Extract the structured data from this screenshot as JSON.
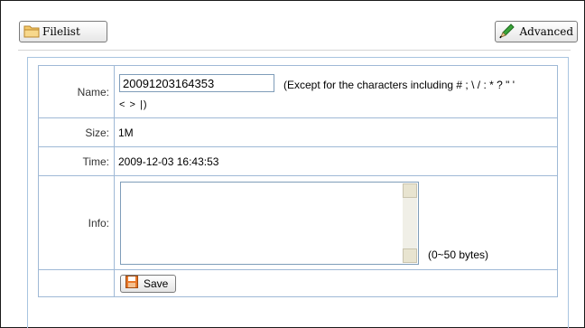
{
  "toolbar": {
    "filelist_label": "Filelist",
    "filelist_icon": "folder-icon",
    "advanced_label": "Advanced",
    "advanced_icon": "pencil-icon"
  },
  "form": {
    "name_label": "Name:",
    "name_value": "20091203164353",
    "name_hint_line1": "(Except for the characters including # ; \\ / : * ? \" '",
    "name_hint_line2": "< > |)",
    "size_label": "Size:",
    "size_value": "1M",
    "time_label": "Time:",
    "time_value": "2009-12-03 16:43:53",
    "info_label": "Info:",
    "info_value": "",
    "info_limit": "(0~50 bytes)",
    "save_label": "Save",
    "save_icon": "floppy-disk-icon"
  },
  "colors": {
    "table_border": "#9fb9d6",
    "panel_border": "#a8c4e0",
    "input_border": "#7f9db9"
  }
}
